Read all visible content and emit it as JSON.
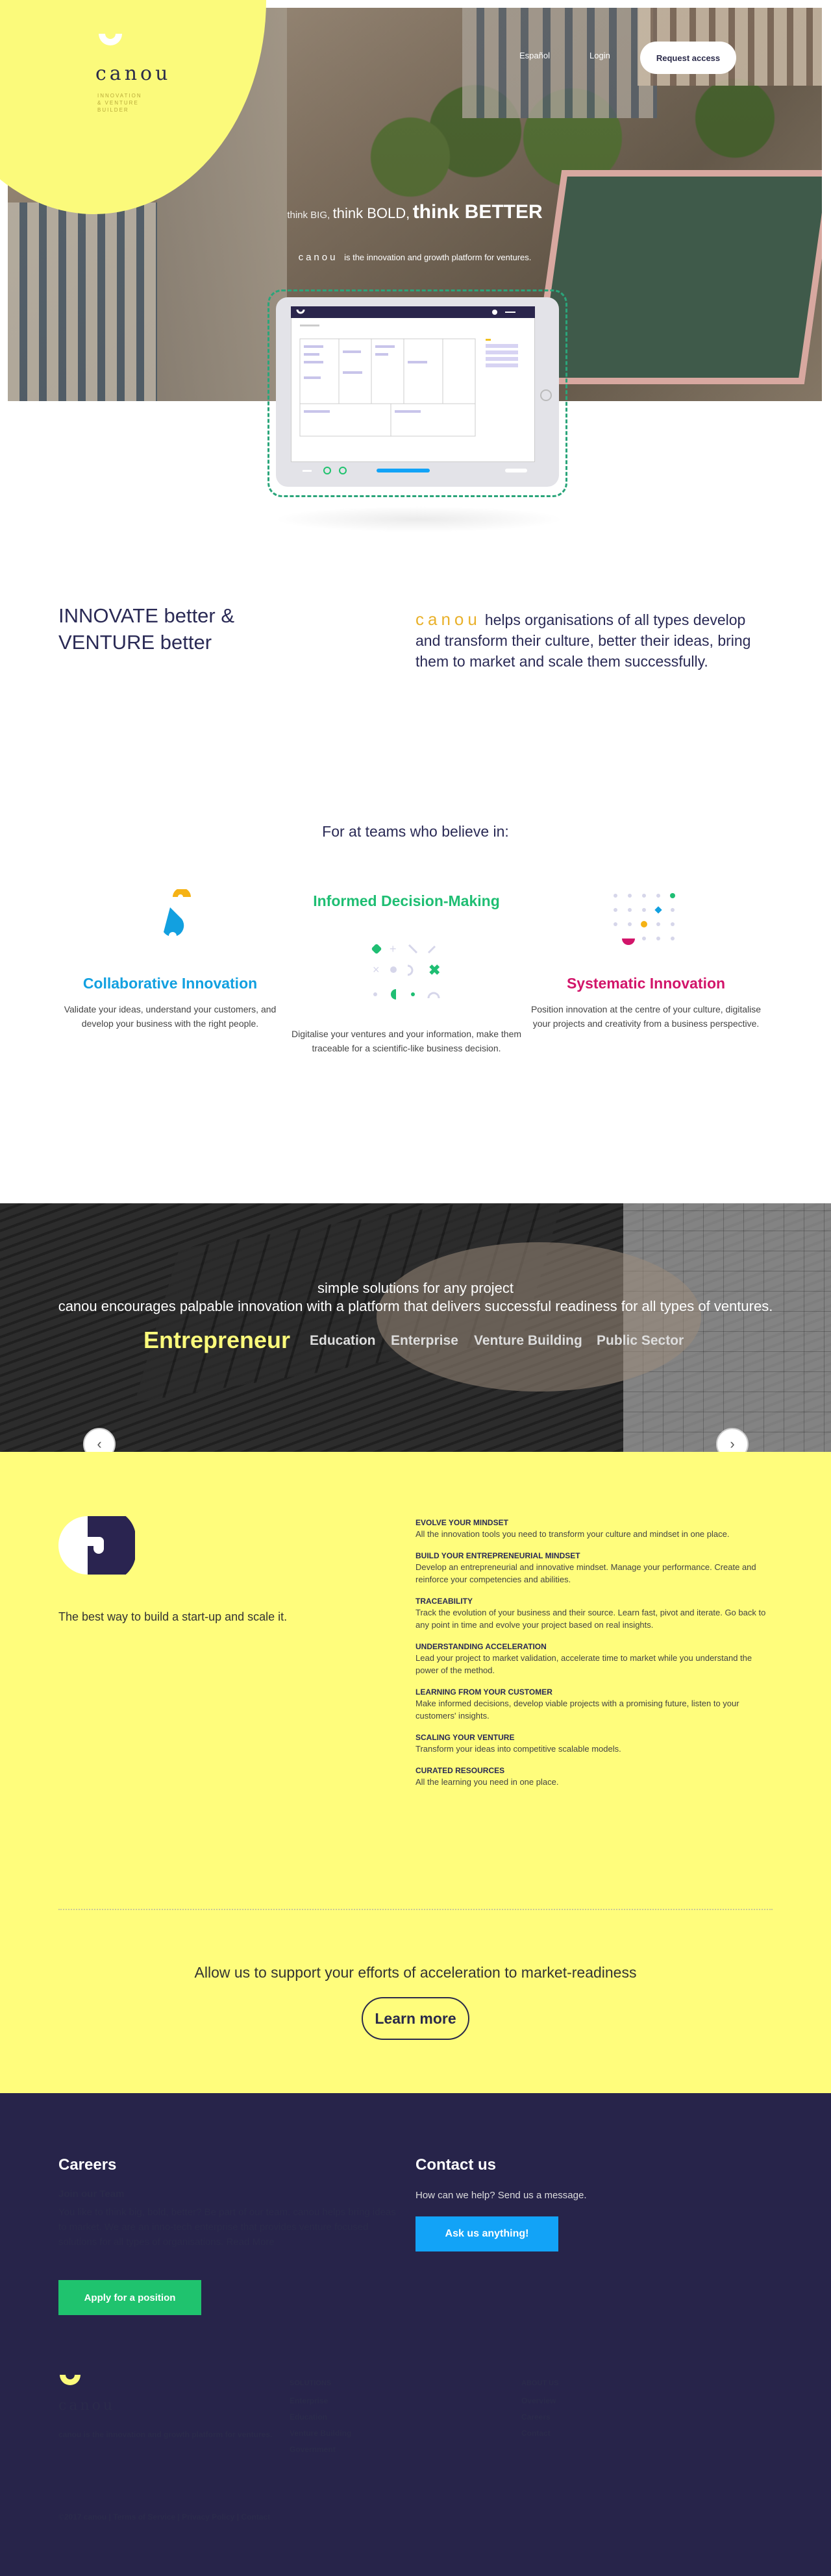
{
  "brand": {
    "name": "canou",
    "sub_lines": [
      "INNOVATION",
      "& VENTURE",
      "BUILDER"
    ]
  },
  "nav": {
    "lang": "Español",
    "login": "Login",
    "request": "Request access"
  },
  "hero": {
    "t1": "think BIG,",
    "t2": "think BOLD,",
    "t3": "think BETTER",
    "sub_brand": "canou",
    "sub_text": "is the innovation and growth platform for ventures."
  },
  "intro": {
    "heading": "INNOVATE better & VENTURE better",
    "brand": "canou",
    "body": "helps organisations of all types develop and transform their culture, better their ideas, bring them to market and scale them successfully."
  },
  "believe": "For at teams who believe in:",
  "features": [
    {
      "title": "Collaborative Innovation",
      "desc": "Validate your ideas, understand your customers, and develop your business with the right people.",
      "color": "#12a0e0"
    },
    {
      "title": "Informed Decision-Making",
      "desc": "Digitalise your ventures and your information, make them traceable for a scientific-like business decision.",
      "color": "#1fbe73"
    },
    {
      "title": "Systematic Innovation",
      "desc": "Position innovation at the centre of your culture, digitalise your projects and creativity from a business perspective.",
      "color": "#d2156a"
    }
  ],
  "banner": {
    "line1": "simple solutions for any project",
    "line2": "canou encourages palpable innovation with a platform that delivers successful readiness for all types of ventures.",
    "tabs": [
      "Entrepreneur",
      "Education",
      "Enterprise",
      "Venture Building",
      "Public Sector"
    ]
  },
  "startup": {
    "tagline": "The best way to build a start-up and scale it.",
    "items": [
      {
        "title": "EVOLVE YOUR MINDSET",
        "desc": "All the innovation tools you need to transform your culture and mindset in one place."
      },
      {
        "title": "BUILD YOUR ENTREPRENEURIAL MINDSET",
        "desc": "Develop an entrepreneurial and innovative mindset. Manage your performance. Create and reinforce your competencies and abilities."
      },
      {
        "title": "TRACEABILITY",
        "desc": "Track the evolution of your business and their source. Learn fast, pivot and iterate. Go back to any point in time and evolve your project based on real insights."
      },
      {
        "title": "UNDERSTANDING ACCELERATION",
        "desc": "Lead your project to market validation, accelerate time to market while you understand the power of the method."
      },
      {
        "title": "LEARNING FROM YOUR CUSTOMER",
        "desc": "Make informed decisions, develop viable projects with a promising future, listen to your customers' insights."
      },
      {
        "title": "SCALING YOUR VENTURE",
        "desc": "Transform your ideas into competitive scalable models."
      },
      {
        "title": "CURATED RESOURCES",
        "desc": "All the learning you need in one place."
      }
    ],
    "cta": "Allow us to support your efforts of acceleration to market-readiness",
    "learn_more": "Learn more"
  },
  "footer": {
    "careers_title": "Careers",
    "join": "Join our Team",
    "careers_text": "You like to think big, bold, better? Be part of our team. canou helps bring ideas to market. We are an inno-tech enterprise that provides venture focused solutions for all types of organisations. Read More",
    "apply": "Apply for a position",
    "contact_title": "Contact us",
    "help": "How can we help? Send us a message.",
    "ask": "Ask us anything!",
    "tagline": "canou is the innovation and growth platform for ventures.",
    "solutions_title": "SOLUTIONS",
    "solutions": [
      "Enterprise",
      "Education",
      "Venture Building",
      "Government"
    ],
    "about_title": "ABOUT US",
    "about": [
      "Overview",
      "Careers",
      "Contact"
    ],
    "bottom": "©2017 canou | Terms of Service | Privacy Policy | Contact"
  },
  "colors": {
    "yellow": "#fffd7c",
    "navy": "#27244a",
    "green": "#1fc36e",
    "blue": "#12a3f7",
    "gold": "#e9b12b"
  }
}
